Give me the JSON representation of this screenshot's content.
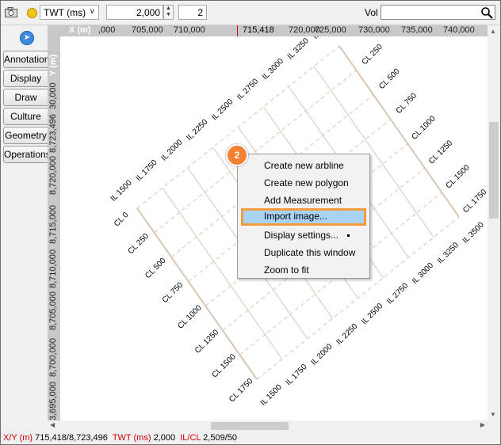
{
  "toolbar": {
    "domain_value": "TWT (ms)",
    "value": "2,000",
    "step": "2",
    "vol_label": "Vol",
    "search_value": ""
  },
  "side_tabs": [
    "Annotation",
    "Display",
    "Draw",
    "Culture",
    "Geometry",
    "Operations"
  ],
  "x_axis": {
    "label": "X (m)",
    "ticks": [
      ",000",
      "705,000",
      "710,000",
      "715,418",
      "720,000",
      "725,000",
      "730,000",
      "735,000",
      "740,000"
    ]
  },
  "y_axis": {
    "label": "Y (m)",
    "ticks": [
      "30,000",
      "8,723,496",
      "8,720,000",
      "8,715,000",
      "8,710,000",
      "8,705,000",
      "8,700,000",
      "3,695,000"
    ]
  },
  "inline_labels": [
    "IL 1500",
    "IL 1750",
    "IL 2000",
    "IL 2250",
    "IL 2500",
    "IL 2750",
    "IL 3000",
    "IL 3250",
    "IL 3500"
  ],
  "crossline_labels": [
    "CL 0",
    "CL 250",
    "CL 500",
    "CL 750",
    "CL 1000",
    "CL 1250",
    "CL 1500",
    "CL 1750"
  ],
  "context_menu": {
    "items": [
      "Create new arbline",
      "Create new polygon",
      "Add Measurement",
      "Import image...",
      "Display settings...",
      "Duplicate this window",
      "Zoom to fit"
    ],
    "highlighted": "Import image..."
  },
  "step_badge": "2",
  "status": {
    "xy_label": "X/Y (m)",
    "xy_value": "715,418/8,723,496",
    "twt_label": "TWT (ms)",
    "twt_value": "2,000",
    "ilcl_label": "IL/CL",
    "ilcl_value": "2,509/50"
  },
  "colors": {
    "accent": "#f39a3d",
    "highlight": "#a9d3f5",
    "survey_line": "#d9c6b6",
    "status_label": "#d00000"
  }
}
